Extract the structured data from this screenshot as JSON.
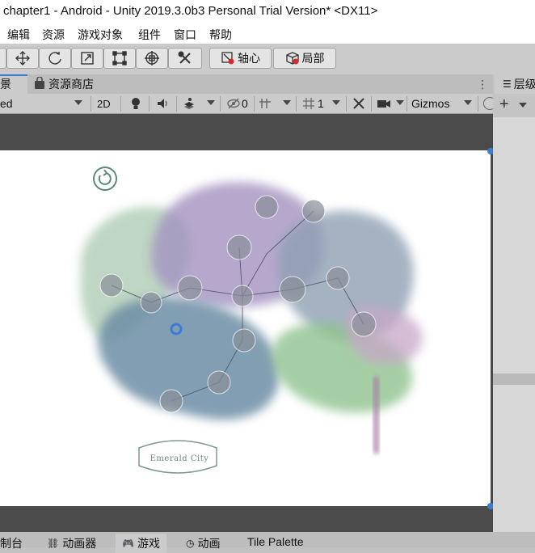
{
  "window": {
    "title": "chapter1 - Android - Unity 2019.3.0b3 Personal Trial Version* <DX11>"
  },
  "menu": {
    "items": [
      "编辑",
      "资源",
      "游戏对象",
      "组件",
      "窗口",
      "帮助"
    ]
  },
  "toolbar": {
    "pivot_label": "轴心",
    "local_label": "局部"
  },
  "tabs": {
    "scene_label": "景",
    "asset_store_label": "资源商店",
    "hierarchy_label": "层级"
  },
  "scene_toolbar": {
    "shading_label": "ed",
    "mode_2d_label": "2D",
    "hidden_count": "0",
    "grid_count": "1",
    "gizmos_label": "Gizmos"
  },
  "game_view": {
    "badge_text": "Emerald City"
  },
  "bottom_tabs": [
    "制台",
    "动画器",
    "游戏",
    "动画",
    "Tile Palette"
  ],
  "colors": {
    "accent_blue": "#3a7bd5",
    "toolbar_bg": "#cbcbcb",
    "scene_bg": "#4b4b4b"
  }
}
